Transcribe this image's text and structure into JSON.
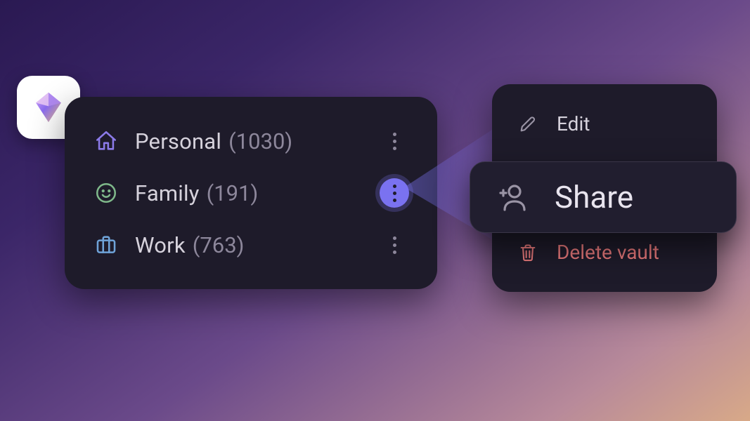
{
  "app": {
    "icon_name": "diamond-app-icon"
  },
  "vaults": [
    {
      "icon": "home-icon",
      "icon_color": "#8b7ae8",
      "label": "Personal",
      "count": "(1030)"
    },
    {
      "icon": "smile-icon",
      "icon_color": "#7fb88a",
      "label": "Family",
      "count": "(191)"
    },
    {
      "icon": "briefcase-icon",
      "icon_color": "#6fa3d8",
      "label": "Work",
      "count": "(763)"
    }
  ],
  "active_more_index": 1,
  "context_menu": {
    "edit_label": "Edit",
    "delete_label": "Delete vault"
  },
  "share_callout": {
    "label": "Share"
  },
  "colors": {
    "card_bg": "#1e1b2a",
    "text_primary": "#d6d2dc",
    "text_secondary": "#8d879b",
    "accent": "#7a72f0",
    "danger": "#e6787a"
  }
}
